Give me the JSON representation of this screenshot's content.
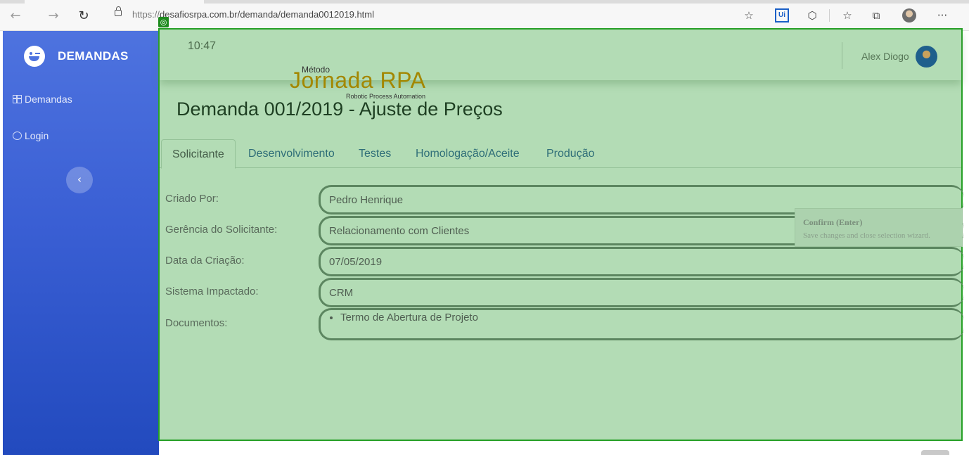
{
  "browser": {
    "url_scheme": "https://",
    "url_rest": "desafiosrpa.com.br/demanda/demanda0012019.html",
    "ui_badge": "Ui",
    "more_label": "···"
  },
  "sidebar": {
    "brand": "DEMANDAS",
    "items": [
      {
        "label": "Demandas",
        "icon": "table-icon"
      },
      {
        "label": "Login",
        "icon": "user-circle-icon"
      }
    ],
    "toggle_glyph": "‹"
  },
  "topbar": {
    "time": "10:47",
    "user_name": "Alex Diogo"
  },
  "logo": {
    "small": "Método",
    "main": "Jornada RPA",
    "sub": "Robotic Process Automation"
  },
  "page_title": "Demanda 001/2019 - Ajuste de Preços",
  "tabs": [
    {
      "label": "Solicitante",
      "active": true
    },
    {
      "label": "Desenvolvimento"
    },
    {
      "label": "Testes"
    },
    {
      "label": "Homologação/Aceite"
    },
    {
      "label": "Produção"
    }
  ],
  "form": {
    "criado_por_label": "Criado Por:",
    "criado_por_value": "Pedro Henrique",
    "gerencia_label": "Gerência do Solicitante:",
    "gerencia_value": "Relacionamento com Clientes",
    "data_label": "Data da Criação:",
    "data_value": "07/05/2019",
    "sistema_label": "Sistema Impactado:",
    "sistema_value": "CRM",
    "documentos_label": "Documentos:",
    "documentos": [
      "Termo de Abertura de Projeto"
    ]
  },
  "tooltip": {
    "title": "Confirm (Enter)",
    "description": "Save changes and close selection wizard."
  },
  "colors": {
    "sidebar_top": "#4e73df",
    "sidebar_bottom": "#224abe",
    "overlay_green": "#b3dcb5",
    "overlay_border": "#26a026",
    "logo_gold": "#a38700"
  }
}
